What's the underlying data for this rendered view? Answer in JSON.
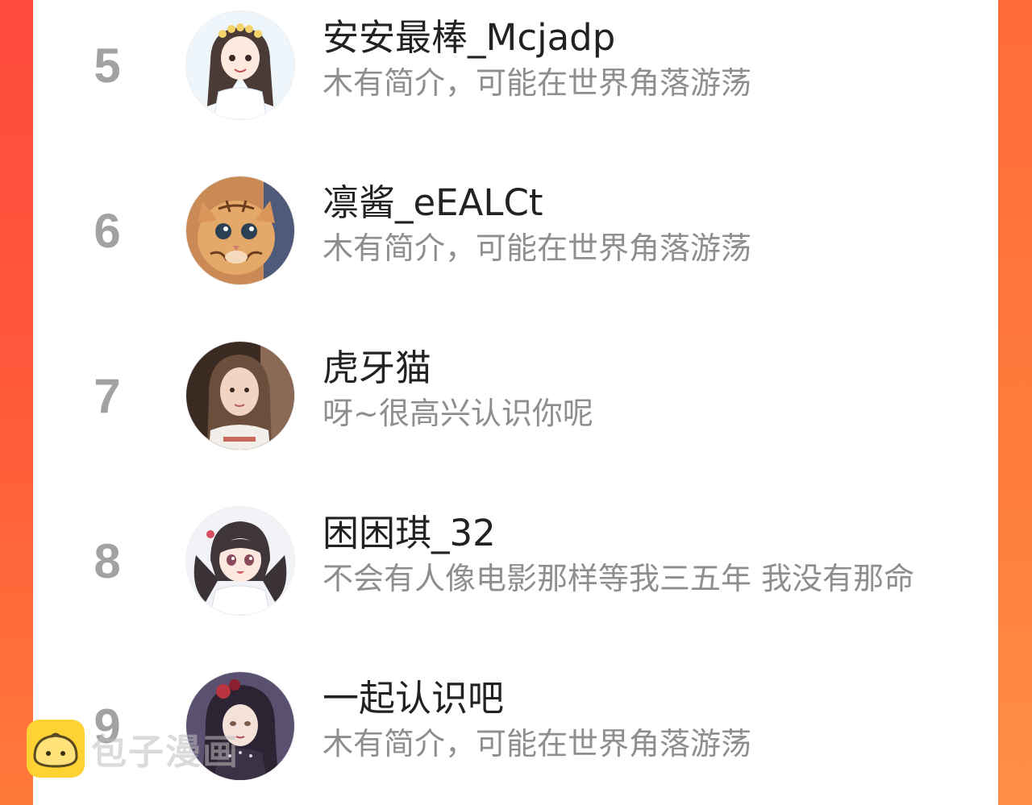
{
  "rows": [
    {
      "rank": "5",
      "name": "安安最棒_Mcjadp",
      "bio": "木有简介，可能在世界角落游荡",
      "avatar_icon": "anime-girl-flower-crown-avatar"
    },
    {
      "rank": "6",
      "name": "凛酱_eEALCt",
      "bio": "木有简介，可能在世界角落游荡",
      "avatar_icon": "tiger-kitten-avatar"
    },
    {
      "rank": "7",
      "name": "虎牙猫",
      "bio": "呀~很高兴认识你呢",
      "avatar_icon": "girl-photo-avatar"
    },
    {
      "rank": "8",
      "name": "困困琪_32",
      "bio": "不会有人像电影那样等我三五年 我没有那命",
      "avatar_icon": "anime-girl-twintails-avatar"
    },
    {
      "rank": "9",
      "name": "一起认识吧",
      "bio": "木有简介，可能在世界角落游荡",
      "avatar_icon": "gothic-doll-avatar"
    }
  ],
  "watermark": {
    "text": "包子漫画",
    "icon": "baozi-logo-icon"
  },
  "colors": {
    "background_left": "#ff4a3d",
    "background_right": "#ff7d3b",
    "panel": "#ffffff",
    "rank": "#a2a2a2",
    "name": "#222222",
    "bio": "#8e8e8e"
  }
}
